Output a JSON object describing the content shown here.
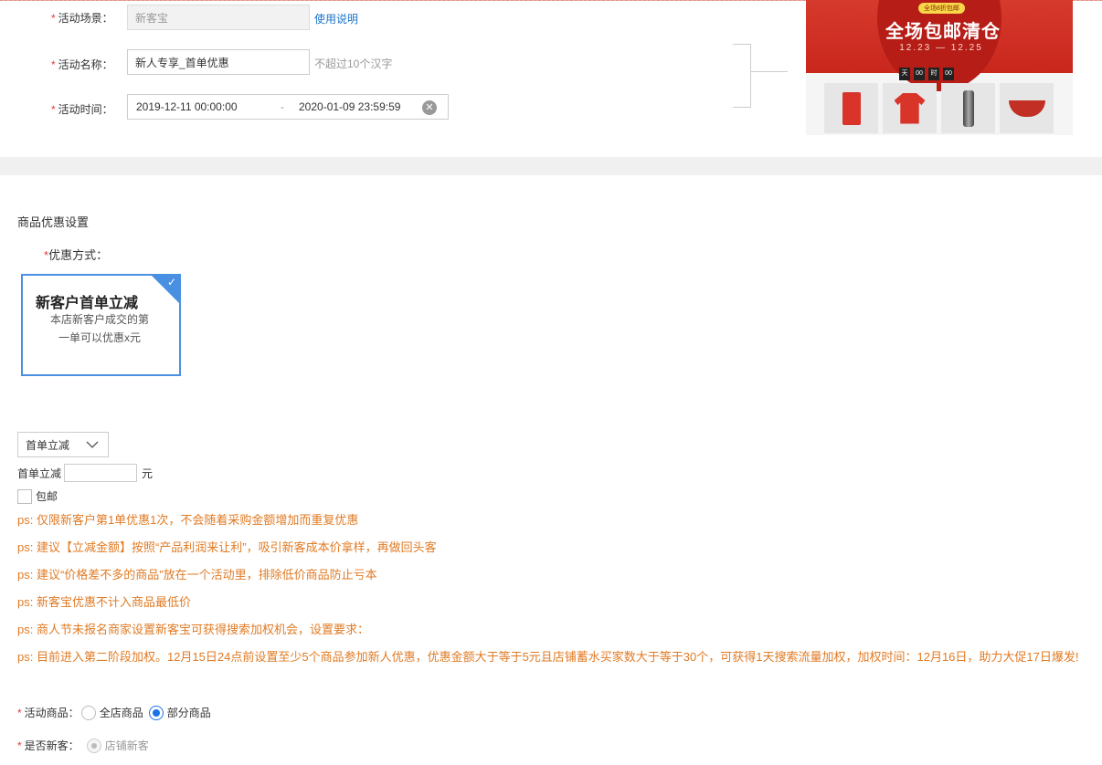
{
  "activity": {
    "scene_label": "活动场景：",
    "scene_value": "新客宝",
    "scene_help": "使用说明",
    "name_label": "活动名称：",
    "name_value": "新人专享_首单优惠",
    "name_hint": "不超过10个汉字",
    "time_label": "活动时间：",
    "time_start": "2019-12-11 00:00:00",
    "time_sep": "-",
    "time_end": "2020-01-09 23:59:59"
  },
  "preview": {
    "tag": "全场8折包邮",
    "headline": "全场包邮清仓",
    "dates": "12.23 — 12.25",
    "timer": [
      "天",
      "00",
      "时",
      "00"
    ]
  },
  "discount": {
    "section_title": "商品优惠设置",
    "method_label": "优惠方式：",
    "card_title": "新客户首单立减",
    "card_desc": "本店新客户成交的第一单可以优惠x元",
    "select_value": "首单立减",
    "amount_label": "首单立减",
    "amount_value": "",
    "amount_unit": "元",
    "free_shipping_label": "包邮"
  },
  "notes": [
    "ps: 仅限新客户第1单优惠1次，不会随着采购金额增加而重复优惠",
    "ps: 建议【立减金额】按照“产品利润来让利”，吸引新客成本价拿样，再做回头客",
    "ps: 建议“价格差不多的商品”放在一个活动里，排除低价商品防止亏本",
    "ps: 新客宝优惠不计入商品最低价",
    "ps: 商人节未报名商家设置新客宝可获得搜索加权机会，设置要求：",
    "ps: 目前进入第二阶段加权。12月15日24点前设置至少5个商品参加新人优惠，优惠金额大于等于5元且店铺蓄水买家数大于等于30个，可获得1天搜索流量加权，加权时间：12月16日，助力大促17日爆发!"
  ],
  "goods": {
    "label": "活动商品：",
    "option_all": "全店商品",
    "option_part": "部分商品",
    "new_label": "是否新客：",
    "new_option": "店铺新客"
  },
  "colors": {
    "accent": "#4a90e2",
    "required": "#e4393c",
    "note": "#e07b25",
    "link": "#1a73c8"
  }
}
